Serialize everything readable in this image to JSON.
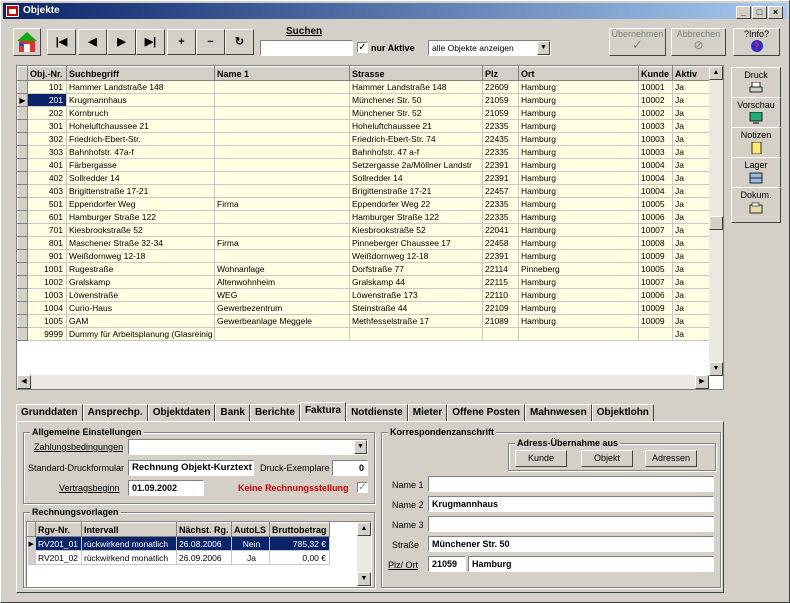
{
  "window": {
    "title": "Objekte"
  },
  "toolbar": {
    "search_label": "Suchen",
    "search_value": "",
    "only_active_label": "nur Aktive",
    "filter_value": "alle Objekte anzeigen",
    "apply_label": "Übernehmen",
    "cancel_label": "Abbrechen",
    "info_label": "?Info?",
    "nav": [
      "|◀",
      "◀",
      "▶",
      "▶|",
      "+",
      "−",
      "↻"
    ]
  },
  "grid": {
    "columns": [
      "Obj.-Nr.",
      "Suchbegriff",
      "Name 1",
      "Strasse",
      "Plz",
      "Ort",
      "Kunde",
      "Aktiv"
    ],
    "rows": [
      [
        "101",
        "Hammer Landstraße 148",
        "",
        "Hammer Landstraße 148",
        "22609",
        "Hamburg",
        "10001",
        "Ja"
      ],
      [
        "201",
        "Krugmannhaus",
        "",
        "Münchener Str. 50",
        "21059",
        "Hamburg",
        "10002",
        "Ja"
      ],
      [
        "202",
        "Kornbruch",
        "",
        "Münchener Str. 52",
        "21059",
        "Hamburg",
        "10002",
        "Ja"
      ],
      [
        "301",
        "Hoheluftchaussee 21",
        "",
        "Hoheluftchaussee 21",
        "22335",
        "Hamburg",
        "10003",
        "Ja"
      ],
      [
        "302",
        "Friedrich-Ebert-Str.",
        "",
        "Friedrich-Ebert-Str. 74",
        "22435",
        "Hamburg",
        "10003",
        "Ja"
      ],
      [
        "303",
        "Bahnhofstr. 47a-f",
        "",
        "Bahnhofstr. 47 a-f",
        "22335",
        "Hamburg",
        "10003",
        "Ja"
      ],
      [
        "401",
        "Färbergasse",
        "",
        "Setzergasse 2a/Möllner Landstr",
        "22391",
        "Hamburg",
        "10004",
        "Ja"
      ],
      [
        "402",
        "Sollredder 14",
        "",
        "Sollredder 14",
        "22391",
        "Hamburg",
        "10004",
        "Ja"
      ],
      [
        "403",
        "Brigittenstraße 17-21",
        "",
        "Brigittenstraße 17-21",
        "22457",
        "Hamburg",
        "10004",
        "Ja"
      ],
      [
        "501",
        "Eppendorfer Weg",
        "Firma",
        "Eppendorfer Weg 22",
        "22335",
        "Hamburg",
        "10005",
        "Ja"
      ],
      [
        "601",
        "Hamburger Straße 122",
        "",
        "Hamburger Straße 122",
        "22335",
        "Hamburg",
        "10006",
        "Ja"
      ],
      [
        "701",
        "Kiesbrookstraße 52",
        "",
        "Kiesbrookstraße 52",
        "22041",
        "Hamburg",
        "10007",
        "Ja"
      ],
      [
        "801",
        "Maschener Straße 32-34",
        "Firma",
        "Pinneberger Chaussee 17",
        "22458",
        "Hamburg",
        "10008",
        "Ja"
      ],
      [
        "901",
        "Weißdornweg 12-18",
        "",
        "Weißdornweg 12-18",
        "22391",
        "Hamburg",
        "10009",
        "Ja"
      ],
      [
        "1001",
        "Rugestraße",
        "Wohnanlage",
        "Dorfstraße 77",
        "22114",
        "Pinneberg",
        "10005",
        "Ja"
      ],
      [
        "1002",
        "Gralskamp",
        "Altenwohnheim",
        "Gralskamp 44",
        "22115",
        "Hamburg",
        "10007",
        "Ja"
      ],
      [
        "1003",
        "Löwenstraße",
        "WEG",
        "Löwenstraße 173",
        "22110",
        "Hamburg",
        "10006",
        "Ja"
      ],
      [
        "1004",
        "Curio-Haus",
        "Gewerbezentrum",
        "Steinstraße 44",
        "22109",
        "Hamburg",
        "10009",
        "Ja"
      ],
      [
        "1005",
        "GAM",
        "Gewerbeanlage Meggele",
        "Methfesselstraße 17",
        "21089",
        "Hamburg",
        "10009",
        "Ja"
      ],
      [
        "9999",
        "Dummy für Arbeitsplanung (Glasreinig",
        "",
        "",
        "",
        "",
        "",
        "Ja"
      ]
    ]
  },
  "side_buttons": [
    "Druck",
    "Vorschau",
    "Notizen",
    "Lager",
    "Dokum."
  ],
  "tabs": [
    "Grunddaten",
    "Ansprechp.",
    "Objektdaten",
    "Bank",
    "Berichte",
    "Faktura",
    "Notdienste",
    "Mieter",
    "Offene Posten",
    "Mahnwesen",
    "Objektlohn"
  ],
  "active_tab": "Faktura",
  "allgemein": {
    "title": "Allgemeine Einstellungen",
    "zahlung_label": "Zahlungsbedingungen",
    "zahlung_value": "",
    "formular_label": "Standard-Druckformular",
    "formular_value": "Rechnung Objekt-Kurztext",
    "exemplare_label": "Druck-Exemplare",
    "exemplare_value": "0",
    "beginn_label": "Vertragsbeginn",
    "beginn_value": "01.09.2002",
    "keine_label": "Keine Rechnungsstellung"
  },
  "rechnung": {
    "title": "Rechnungsvorlagen",
    "columns": [
      "Rgv-Nr.",
      "Intervall",
      "Nächst. Rg.",
      "AutoLS",
      "Bruttobetrag"
    ],
    "rows": [
      [
        "RV201_01",
        "rückwirkend monatlich",
        "26.08.2006",
        "Nein",
        "785,32 €"
      ],
      [
        "RV201_02",
        "rückwirkend monatlich",
        "26.09.2006",
        "Ja",
        "0,00 €"
      ]
    ]
  },
  "korr": {
    "title": "Korrespondenzanschrift",
    "adress_title": "Adress-Übernahme aus",
    "btn_kunde": "Kunde",
    "btn_objekt": "Objekt",
    "btn_adressen": "Adressen",
    "name1_label": "Name 1",
    "name1_value": "",
    "name2_label": "Name 2",
    "name2_value": "Krugmannhaus",
    "name3_label": "Name 3",
    "name3_value": "",
    "strasse_label": "Straße",
    "strasse_value": "Münchener Str. 50",
    "plzort_label": "Plz/ Ort",
    "plz_value": "21059",
    "ort_value": "Hamburg"
  }
}
